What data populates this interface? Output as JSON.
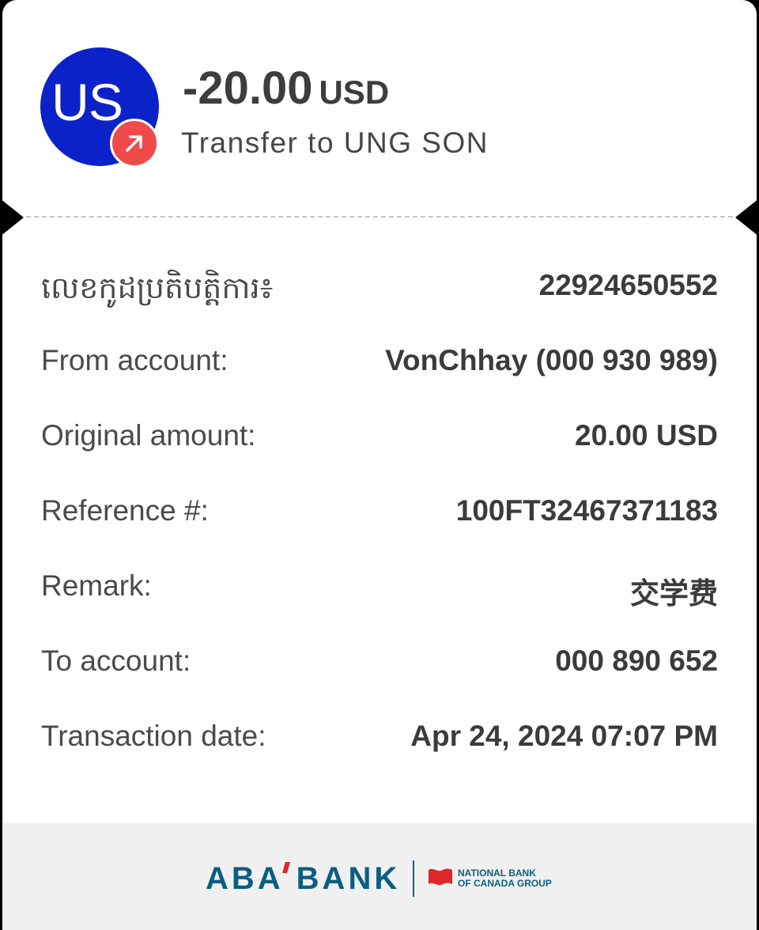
{
  "header": {
    "avatar_initials": "US",
    "amount": "-20.00",
    "currency": "USD",
    "subtitle": "Transfer to UNG SON",
    "avatar_color": "#0c22c9",
    "badge_color": "#f04a4a"
  },
  "details": [
    {
      "label": "លេខកូដប្រតិបត្តិការ៖",
      "value": "22924650552"
    },
    {
      "label": "From account:",
      "value": "VonChhay (000 930 989)"
    },
    {
      "label": "Original amount:",
      "value": "20.00 USD"
    },
    {
      "label": "Reference #:",
      "value": "100FT32467371183"
    },
    {
      "label": "Remark:",
      "value": "交学费"
    },
    {
      "label": "To account:",
      "value": "000 890 652"
    },
    {
      "label": "Transaction date:",
      "value": "Apr 24, 2024 07:07 PM"
    }
  ],
  "footer": {
    "bank_name_part1": "ABA",
    "bank_name_part2": "BANK",
    "group_line1": "NATIONAL BANK",
    "group_line2": "OF CANADA GROUP",
    "brand_color": "#0a5e82",
    "accent_color": "#e0262b"
  }
}
